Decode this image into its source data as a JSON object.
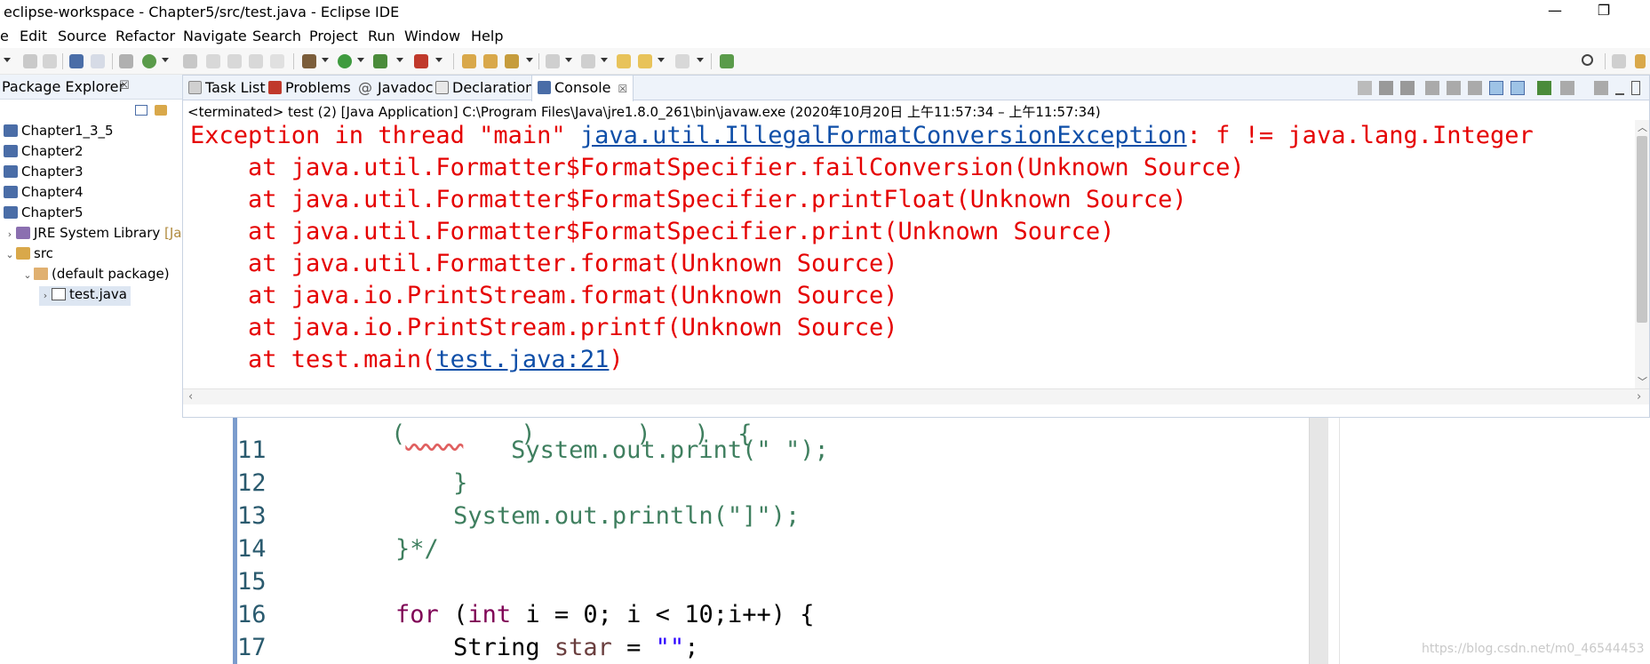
{
  "window": {
    "title": "eclipse-workspace - Chapter5/src/test.java - Eclipse IDE",
    "minimize_glyph": "—",
    "restore_glyph": "❐"
  },
  "menu": [
    "e",
    "Edit",
    "Source",
    "Refactor",
    "Navigate",
    "Search",
    "Project",
    "Run",
    "Window",
    "Help"
  ],
  "toolbar_icons": [
    "new-icon",
    "save-icon",
    "save-all-icon",
    "terminal-icon",
    "skip-breakpoints-icon",
    "new-java-project-icon",
    "pin-icon",
    "bug-icon",
    "debug-icon",
    "run-icon",
    "run-coverage-icon",
    "external-tools-icon",
    "new-class-icon",
    "open-type-icon",
    "open-task-icon",
    "search-icon",
    "next-annotation-icon",
    "prev-annotation-icon",
    "back-icon",
    "forward-icon",
    "last-edit-icon",
    "open-perspective-icon"
  ],
  "package_explorer": {
    "tab_label": "Package Explorer",
    "close_glyph": "☒",
    "items": [
      {
        "label": "Chapter1_3_5",
        "level": "project"
      },
      {
        "label": "Chapter2",
        "level": "project"
      },
      {
        "label": "Chapter3",
        "level": "project"
      },
      {
        "label": "Chapter4",
        "level": "project"
      },
      {
        "label": "Chapter5",
        "level": "project"
      },
      {
        "label": "JRE System Library",
        "suffix": "[Ja",
        "level": "library"
      },
      {
        "label": "src",
        "level": "folder"
      },
      {
        "label": "(default package)",
        "level": "package"
      },
      {
        "label": "test.java",
        "level": "file"
      }
    ]
  },
  "console": {
    "tabs": [
      {
        "label": "Task List",
        "icon": "task-list-icon"
      },
      {
        "label": "Problems",
        "icon": "problems-icon"
      },
      {
        "label": "Javadoc",
        "icon": "javadoc-icon",
        "prefix": "@"
      },
      {
        "label": "Declaration",
        "icon": "declaration-icon"
      },
      {
        "label": "Console",
        "icon": "console-icon",
        "active": true
      }
    ],
    "tab_close_glyph": "☒",
    "status": "<terminated> test (2) [Java Application] C:\\Program Files\\Java\\jre1.8.0_261\\bin\\javaw.exe  (2020年10月20日 上午11:57:34 – 上午11:57:34)",
    "exception_prefix": "Exception in thread \"main\" ",
    "exception_class": "java.util.IllegalFormatConversionException",
    "exception_message": ": f != java.lang.Integer",
    "stack": [
      "\tat java.util.Formatter$FormatSpecifier.failConversion(Unknown Source)",
      "\tat java.util.Formatter$FormatSpecifier.printFloat(Unknown Source)",
      "\tat java.util.Formatter$FormatSpecifier.print(Unknown Source)",
      "\tat java.util.Formatter.format(Unknown Source)",
      "\tat java.io.PrintStream.format(Unknown Source)",
      "\tat java.io.PrintStream.printf(Unknown Source)"
    ],
    "last_frame_prefix": "\tat test.main(",
    "last_frame_link": "test.java:21",
    "last_frame_suffix": ")"
  },
  "editor": {
    "lines": [
      {
        "num": "11",
        "code": "                System.out.print(\" \");"
      },
      {
        "num": "12",
        "code": "            }"
      },
      {
        "num": "13",
        "code": "            System.out.println(\"]\");"
      },
      {
        "num": "14",
        "code": "        }*/"
      },
      {
        "num": "15",
        "code": ""
      },
      {
        "num": "16",
        "code": "        for (int i = 0; i < 10;i++) {"
      },
      {
        "num": "17",
        "code": "            String star = \"\";"
      }
    ]
  },
  "watermark": "https://blog.csdn.net/m0_46544453",
  "colors": {
    "console_error": "#e50000",
    "link": "#0f4fa8",
    "keyword": "#7f0055",
    "string": "#2a00ff",
    "comment": "#3f7f5f"
  }
}
